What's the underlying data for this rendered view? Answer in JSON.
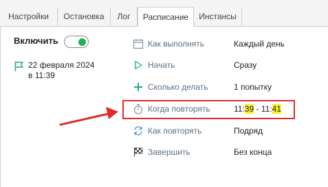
{
  "tabs": [
    {
      "label": "Настройки",
      "active": false
    },
    {
      "label": "Остановка",
      "active": false
    },
    {
      "label": "Лог",
      "active": false
    },
    {
      "label": "Расписание",
      "active": true
    },
    {
      "label": "Инстансы",
      "active": false
    }
  ],
  "enable": {
    "label": "Включить",
    "on": true
  },
  "date": {
    "line1": "22 февраля 2024",
    "line2": "в 11:39"
  },
  "schedule": {
    "how_run": {
      "label": "Как выполнять",
      "value": "Каждый день",
      "icon": "calendar-icon"
    },
    "start": {
      "label": "Начать",
      "value": "Сразу",
      "icon": "play-icon"
    },
    "count": {
      "label": "Сколько делать",
      "value": "1 попытку",
      "icon": "plus-icon"
    },
    "when_repeat": {
      "label": "Когда повторять",
      "value_parts": [
        "11:",
        "39",
        " - 11:",
        "41"
      ],
      "icon": "stopwatch-icon"
    },
    "how_repeat": {
      "label": "Как повторять",
      "value": "Подряд",
      "icon": "repeat-icon"
    },
    "finish": {
      "label": "Завершить",
      "value": "Без конца",
      "icon": "finish-flag-icon"
    }
  },
  "colors": {
    "accent_red": "#e02a2a",
    "toggle_green": "#1ab54a",
    "highlight_yellow": "#f7ef2d",
    "label_gray_blue": "#5b6f80",
    "icon_teal": "#1ea592"
  }
}
